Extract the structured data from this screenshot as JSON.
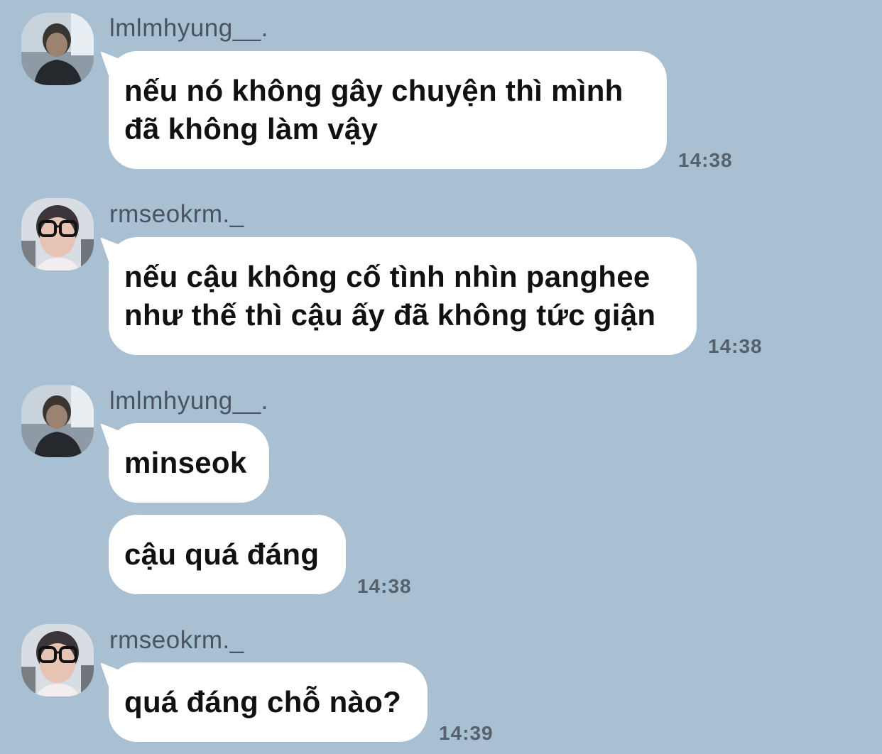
{
  "messages": [
    {
      "sender": "lmlmhyung__.",
      "avatar": "avatar-lmlmhyung",
      "bubbles": [
        {
          "lines": [
            "nếu nó không gây chuyện thì mình",
            "đã không làm vậy"
          ]
        }
      ],
      "time": "14:38"
    },
    {
      "sender": "rmseokrm._",
      "avatar": "avatar-rmseokrm",
      "bubbles": [
        {
          "lines": [
            "nếu cậu không cố tình nhìn panghee",
            "như thế thì cậu ấy đã không tức giận"
          ]
        }
      ],
      "time": "14:38"
    },
    {
      "sender": "lmlmhyung__.",
      "avatar": "avatar-lmlmhyung",
      "bubbles": [
        {
          "lines": [
            "minseok"
          ]
        },
        {
          "lines": [
            "cậu quá đáng"
          ]
        }
      ],
      "time": "14:38"
    },
    {
      "sender": "rmseokrm._",
      "avatar": "avatar-rmseokrm",
      "bubbles": [
        {
          "lines": [
            "quá đáng chỗ nào?"
          ]
        }
      ],
      "time": "14:39"
    }
  ],
  "colors": {
    "background": "#a9bfd2",
    "bubble": "#ffffff",
    "sender_text": "#475461",
    "time_text": "#55626e"
  }
}
